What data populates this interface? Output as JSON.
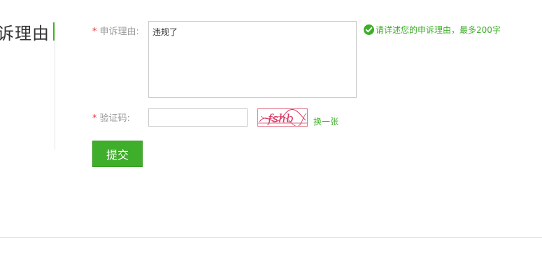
{
  "sidebar": {
    "title": "诉理由"
  },
  "form": {
    "reason": {
      "required_mark": "*",
      "label": "申诉理由:",
      "value": "违规了",
      "hint": "请详述您的申诉理由，最多200字"
    },
    "captcha": {
      "required_mark": "*",
      "label": "验证码:",
      "value": "",
      "image_text": "fshb",
      "refresh_label": "换一张"
    },
    "submit_label": "提交"
  },
  "colors": {
    "accent": "#3fae2a",
    "required": "#e4393c",
    "captcha": "#d9345f"
  },
  "icons": {
    "hint": "check-circle-icon"
  }
}
